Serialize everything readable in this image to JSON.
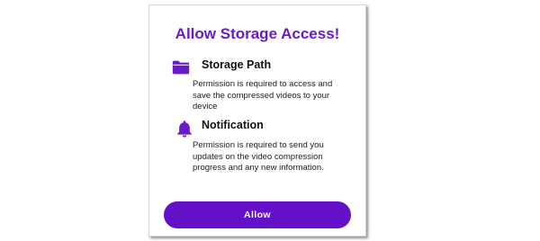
{
  "dialog": {
    "title": "Allow Storage Access!",
    "accent_color": "#6a1bc9",
    "permissions": [
      {
        "icon": "folder-icon",
        "title": "Storage Path",
        "description": "Permission is required to access and save the compressed videos to your device"
      },
      {
        "icon": "bell-icon",
        "title": "Notification",
        "description": "Permission is required to send you updates on the video compression progress and any new information."
      }
    ],
    "allow_label": "Allow",
    "button_color": "#6410c9"
  }
}
